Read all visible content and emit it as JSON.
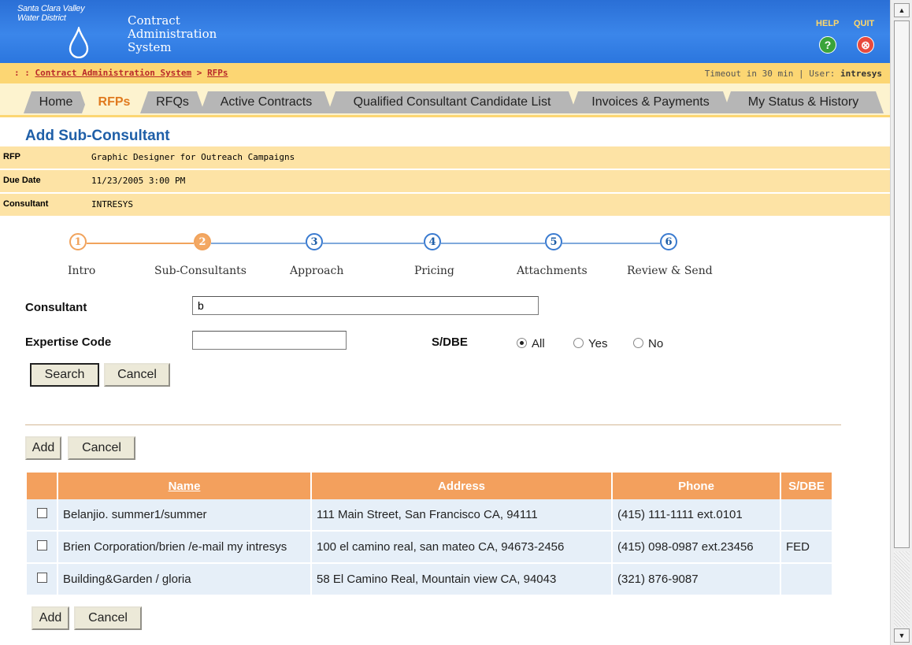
{
  "header": {
    "org_name": "Santa Clara Valley Water District",
    "system_title_lines": [
      "Contract",
      "Administration",
      "System"
    ],
    "help_label": "HELP",
    "quit_label": "QUIT",
    "help_glyph": "?",
    "quit_glyph": "⊗",
    "drop_icon": "water-drop-icon"
  },
  "crumbs": {
    "prefix": ": : ",
    "root": "Contract Administration System",
    "sep": " > ",
    "current": "RFPs",
    "timeout": "Timeout in 30 min",
    "divider": " | ",
    "user_label": "User: ",
    "user": "intresys"
  },
  "tabs": [
    {
      "label": "Home",
      "active": false
    },
    {
      "label": "RFPs",
      "active": true
    },
    {
      "label": "RFQs",
      "active": false
    },
    {
      "label": "Active Contracts",
      "active": false
    },
    {
      "label": "Qualified Consultant Candidate List",
      "active": false
    },
    {
      "label": "Invoices & Payments",
      "active": false
    },
    {
      "label": "My Status & History",
      "active": false
    }
  ],
  "page_title": "Add Sub-Consultant",
  "info": {
    "rfp_label": "RFP",
    "rfp_value": "Graphic Designer for Outreach Campaigns",
    "due_label": "Due Date",
    "due_value": "11/23/2005 3:00 PM",
    "consultant_label": "Consultant",
    "consultant_value": "INTRESYS"
  },
  "steps": [
    {
      "num": "1",
      "label": "Intro",
      "state": "done"
    },
    {
      "num": "2",
      "label": "Sub-Consultants",
      "state": "current"
    },
    {
      "num": "3",
      "label": "Approach",
      "state": "todo"
    },
    {
      "num": "4",
      "label": "Pricing",
      "state": "todo"
    },
    {
      "num": "5",
      "label": "Attachments",
      "state": "todo"
    },
    {
      "num": "6",
      "label": "Review & Send",
      "state": "todo"
    }
  ],
  "search": {
    "consultant_label": "Consultant",
    "consultant_value": "b",
    "expertise_label": "Expertise Code",
    "expertise_value": "",
    "sdbe_label": "S/DBE",
    "sdbe_options": [
      "All",
      "Yes",
      "No"
    ],
    "sdbe_selected": "All",
    "search_button": "Search",
    "cancel_button": "Cancel"
  },
  "actions": {
    "add_label": "Add",
    "cancel_label": "Cancel"
  },
  "table": {
    "columns": [
      "Name",
      "Address",
      "Phone",
      "S/DBE"
    ],
    "rows": [
      {
        "name": "Belanjio. summer1/summer",
        "address": "111 Main Street, San Francisco CA, 94111",
        "phone": "(415) 111-1111 ext.0101",
        "sdbe": ""
      },
      {
        "name": "Brien Corporation/brien /e-mail my intresys",
        "address": "100 el camino real, san mateo CA, 94673-2456",
        "phone": "(415) 098-0987 ext.23456",
        "sdbe": "FED"
      },
      {
        "name": "Building&Garden / gloria",
        "address": "58 El Camino Real, Mountain view CA, 94043",
        "phone": "(321) 876-9087",
        "sdbe": ""
      }
    ]
  },
  "colors": {
    "header_blue": "#3b86ea",
    "crumb_bar": "#fcd673",
    "info_bg": "#fde3a5",
    "table_header": "#f3a05d",
    "table_row": "#e6eff8",
    "step_done": "#f1a35c",
    "step_todo": "#3a7bd0",
    "title_blue": "#1f5fa8"
  }
}
